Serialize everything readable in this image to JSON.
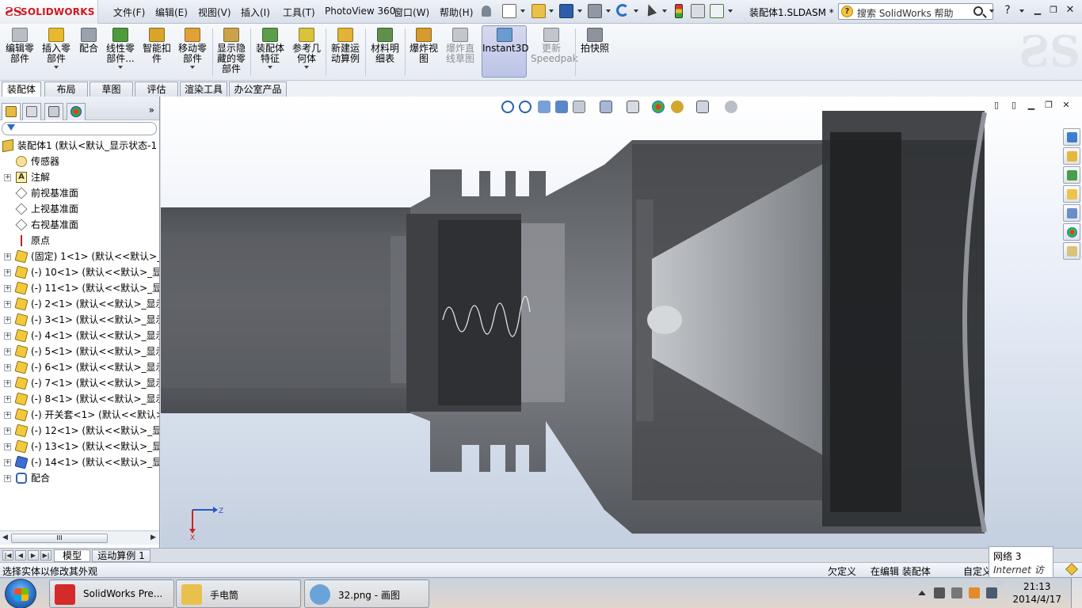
{
  "app": {
    "brand": "SOLIDWORKS",
    "document_title": "装配体1.SLDASM *",
    "menus": [
      "文件(F)",
      "编辑(E)",
      "视图(V)",
      "插入(I)",
      "工具(T)",
      "PhotoView 360",
      "窗口(W)",
      "帮助(H)"
    ],
    "search_placeholder": "搜索 SolidWorks 帮助",
    "help_label": "?"
  },
  "commands": [
    {
      "label": "编辑零\n部件",
      "disabled": true,
      "icon_color": "#b9bec6"
    },
    {
      "label": "插入零\n部件",
      "disabled": false,
      "icon_color": "#e8b82e"
    },
    {
      "label": "配合",
      "disabled": false,
      "icon_color": "#9aa2ad"
    },
    {
      "label": "线性零\n部件...",
      "disabled": false,
      "icon_color": "#4f9a3c"
    },
    {
      "label": "智能扣\n件",
      "disabled": false,
      "icon_color": "#d8a429"
    },
    {
      "label": "移动零\n部件",
      "disabled": false,
      "icon_color": "#e0a03a"
    },
    {
      "label": "显示隐\n藏的零\n部件",
      "disabled": false,
      "icon_color": "#caa24a"
    },
    {
      "label": "装配体\n特征",
      "disabled": false,
      "icon_color": "#5c9e4a"
    },
    {
      "label": "参考几\n何体",
      "disabled": false,
      "icon_color": "#d9c23c"
    },
    {
      "label": "新建运\n动算例",
      "disabled": false,
      "icon_color": "#e3b236"
    },
    {
      "label": "材料明\n细表",
      "disabled": false,
      "icon_color": "#5f8f4c"
    },
    {
      "label": "爆炸视\n图",
      "disabled": false,
      "icon_color": "#d59b2d"
    },
    {
      "label": "爆炸直\n线草图",
      "disabled": true,
      "icon_color": "#c3c7cd"
    },
    {
      "label": "Instant3D",
      "disabled": false,
      "active": true,
      "icon_color": "#6a9bd1"
    },
    {
      "label": "更新\nSpeedpak",
      "disabled": true,
      "icon_color": "#c1c6cd"
    },
    {
      "label": "拍快照",
      "disabled": false,
      "icon_color": "#8d949e"
    }
  ],
  "cm_tabs": [
    "装配体",
    "布局",
    "草图",
    "评估",
    "渲染工具",
    "办公室产品"
  ],
  "feature_tree": [
    {
      "text": "装配体1 (默认<默认_显示状态-1",
      "icon": "asm",
      "expand": false,
      "indent": 0
    },
    {
      "text": "传感器",
      "icon": "sensor",
      "expand": false,
      "indent": 1
    },
    {
      "text": "注解",
      "icon": "note",
      "expand": true,
      "indent": 1
    },
    {
      "text": "前视基准面",
      "icon": "plane",
      "expand": false,
      "indent": 1
    },
    {
      "text": "上视基准面",
      "icon": "plane",
      "expand": false,
      "indent": 1
    },
    {
      "text": "右视基准面",
      "icon": "plane",
      "expand": false,
      "indent": 1
    },
    {
      "text": "原点",
      "icon": "origin",
      "expand": false,
      "indent": 1
    },
    {
      "text": "(固定) 1<1> (默认<<默认>_显",
      "icon": "part",
      "expand": true,
      "indent": 1
    },
    {
      "text": "(-) 10<1> (默认<<默认>_显示",
      "icon": "part",
      "expand": true,
      "indent": 1
    },
    {
      "text": "(-) 11<1> (默认<<默认>_显示",
      "icon": "part",
      "expand": true,
      "indent": 1
    },
    {
      "text": "(-) 2<1> (默认<<默认>_显示",
      "icon": "part",
      "expand": true,
      "indent": 1
    },
    {
      "text": "(-) 3<1> (默认<<默认>_显示",
      "icon": "part",
      "expand": true,
      "indent": 1
    },
    {
      "text": "(-) 4<1> (默认<<默认>_显示",
      "icon": "part",
      "expand": true,
      "indent": 1
    },
    {
      "text": "(-) 5<1> (默认<<默认>_显示",
      "icon": "part",
      "expand": true,
      "indent": 1
    },
    {
      "text": "(-) 6<1> (默认<<默认>_显示",
      "icon": "part",
      "expand": true,
      "indent": 1
    },
    {
      "text": "(-) 7<1> (默认<<默认>_显示",
      "icon": "part",
      "expand": true,
      "indent": 1
    },
    {
      "text": "(-) 8<1> (默认<<默认>_显示",
      "icon": "part",
      "expand": true,
      "indent": 1
    },
    {
      "text": "(-) 开关套<1> (默认<<默认>_",
      "icon": "part",
      "expand": true,
      "indent": 1
    },
    {
      "text": "(-) 12<1> (默认<<默认>_显示",
      "icon": "part",
      "expand": true,
      "indent": 1
    },
    {
      "text": "(-) 13<1> (默认<<默认>_显示",
      "icon": "part",
      "expand": true,
      "indent": 1
    },
    {
      "text": "(-) 14<1> (默认<<默认>_显示",
      "icon": "part-blue",
      "expand": true,
      "indent": 1
    },
    {
      "text": "配合",
      "icon": "mate",
      "expand": true,
      "indent": 1
    }
  ],
  "fm_scroll_grip": "III",
  "triad": {
    "z": "Z",
    "x": "X"
  },
  "model_tabs": [
    "模型",
    "运动算例 1"
  ],
  "status": {
    "message": "选择实体以修改其外观",
    "state1": "欠定义",
    "state2": "在编辑 装配体",
    "state3": "自定义"
  },
  "network_tip": {
    "line1": "网络  3",
    "line2": "Internet 访问"
  },
  "taskbar": {
    "tasks": [
      {
        "label": "SolidWorks Pre...",
        "icon_color": "#d42a2a"
      },
      {
        "label": "手电筒",
        "icon_color": "#e8c14c"
      },
      {
        "label": "32.png - 画图",
        "icon_color": "#6aa3d8"
      }
    ],
    "time": "21:13",
    "date": "2014/4/17"
  },
  "colors": {
    "accent": "#d2161e",
    "part_icon": "#f2c93c",
    "command_active": "#bcc4e6"
  }
}
